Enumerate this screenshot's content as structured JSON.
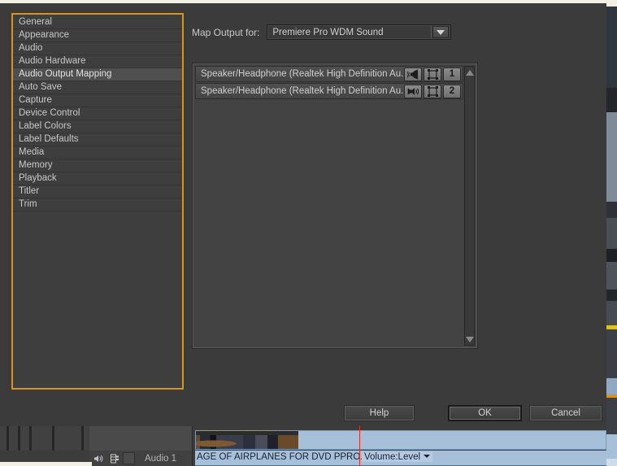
{
  "dialog": {
    "sidebar": {
      "items": [
        {
          "label": "General",
          "selected": false
        },
        {
          "label": "Appearance",
          "selected": false
        },
        {
          "label": "Audio",
          "selected": false
        },
        {
          "label": "Audio Hardware",
          "selected": false
        },
        {
          "label": "Audio Output Mapping",
          "selected": true
        },
        {
          "label": "Auto Save",
          "selected": false
        },
        {
          "label": "Capture",
          "selected": false
        },
        {
          "label": "Device Control",
          "selected": false
        },
        {
          "label": "Label Colors",
          "selected": false
        },
        {
          "label": "Label Defaults",
          "selected": false
        },
        {
          "label": "Media",
          "selected": false
        },
        {
          "label": "Memory",
          "selected": false
        },
        {
          "label": "Playback",
          "selected": false
        },
        {
          "label": "Titler",
          "selected": false
        },
        {
          "label": "Trim",
          "selected": false
        }
      ]
    },
    "map_output": {
      "label": "Map Output for:",
      "selected_value": "Premiere Pro WDM Sound",
      "caret_icon": "chevron-down-icon"
    },
    "mapping_list": {
      "rows": [
        {
          "name": "Speaker/Headphone (Realtek High Definition Au...",
          "speaker_icon": "speaker-left-icon",
          "track_icon": "track-select-icon",
          "channel": "1"
        },
        {
          "name": "Speaker/Headphone (Realtek High Definition Au...",
          "speaker_icon": "speaker-right-icon",
          "track_icon": "track-select-icon",
          "channel": "2"
        }
      ],
      "scrollbar": {
        "up_icon": "scroll-up-arrow-icon",
        "down_icon": "scroll-down-arrow-icon"
      }
    },
    "buttons": {
      "help": "Help",
      "ok": "OK",
      "cancel": "Cancel"
    },
    "colors": {
      "focus_border": "#d8921e",
      "dialog_bg": "#3b3b3b",
      "list_bg": "#434343"
    }
  },
  "timeline": {
    "audio_track": {
      "label": "Audio 1",
      "speaker_icon": "track-output-speaker-icon",
      "sync_icon": "track-lock-sync-icon"
    },
    "clip": {
      "title": "AGE OF AIRPLANES FOR DVD PPRO.mov [A]",
      "volume_label": "Volume:Level",
      "volume_caret_icon": "chevron-down-icon"
    },
    "playhead_icon": "playhead-marker"
  }
}
